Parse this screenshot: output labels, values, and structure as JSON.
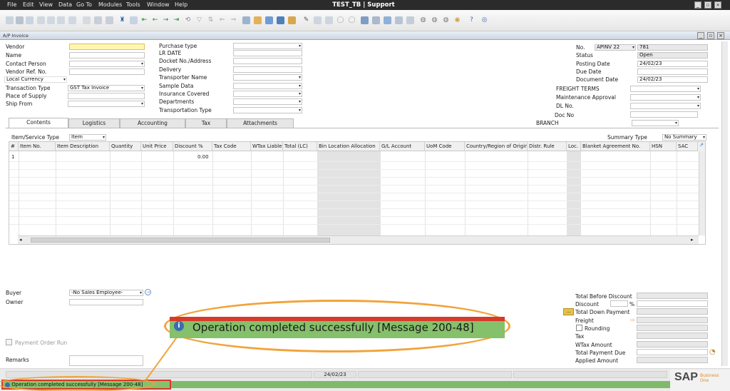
{
  "menu": [
    "File",
    "Edit",
    "View",
    "Data",
    "Go To",
    "Modules",
    "Tools",
    "Window",
    "Help"
  ],
  "app_title": "TEST_TB | Support",
  "window_title": "A/P Invoice",
  "left_fields": [
    {
      "label": "Vendor",
      "value": ""
    },
    {
      "label": "Name",
      "value": ""
    },
    {
      "label": "Contact Person",
      "value": ""
    },
    {
      "label": "Vendor Ref. No.",
      "value": ""
    },
    {
      "label": "Local Currency",
      "value": ""
    },
    {
      "label": "Transaction Type",
      "value": "GST Tax Invoice"
    },
    {
      "label": "Place of Supply",
      "value": ""
    },
    {
      "label": "Ship From",
      "value": ""
    }
  ],
  "mid_fields": [
    "Purchase type",
    "LR DATE",
    "Docket No./Address",
    "Delivery",
    "Transporter Name",
    "Sample Data",
    "Insurance Covered",
    "Departments",
    "Transportation Type"
  ],
  "right_fields": {
    "no_label": "No.",
    "series": "APINV 22",
    "doc_number": "781",
    "status_label": "Status",
    "status_value": "Open",
    "posting_label": "Posting Date",
    "posting_value": "24/02/23",
    "due_label": "Due Date",
    "due_value": "",
    "docdate_label": "Document Date",
    "docdate_value": "24/02/23"
  },
  "right_udf": [
    "FREIGHT TERMS",
    "Maintenance Approval",
    "DL No.",
    "Doc No",
    "BRANCH"
  ],
  "tabs": [
    "Contents",
    "Logistics",
    "Accounting",
    "Tax",
    "Attachments"
  ],
  "item_service_type_label": "Item/Service Type",
  "item_service_type_value": "Item",
  "summary_type_label": "Summary Type",
  "summary_type_value": "No Summary",
  "columns": [
    "#",
    "Item No.",
    "Item Description",
    "Quantity",
    "Unit Price",
    "Discount %",
    "Tax Code",
    "WTax Liable",
    "Total (LC)",
    "Bin Location Allocation",
    "G/L Account",
    "UoM Code",
    "Country/Region of Origin",
    "Distr. Rule",
    "Loc.",
    "Blanket Agreement No.",
    "HSN",
    "SAC"
  ],
  "row1": {
    "num": "1",
    "discount": "0.00"
  },
  "bottom_left": {
    "buyer_label": "Buyer",
    "buyer_value": "-No Sales Employee-",
    "owner_label": "Owner",
    "owner_value": "",
    "payment_order_label": "Payment Order Run",
    "remarks_label": "Remarks"
  },
  "totals": [
    "Total Before Discount",
    "Discount",
    "Total Down Payment",
    "Freight",
    "Rounding",
    "Tax",
    "WTax Amount",
    "Total Payment Due",
    "Applied Amount"
  ],
  "discount_pct": "%",
  "status_date": "24/02/23",
  "message": "Operation completed successfully  [Message 200-48]",
  "brand": "SAP",
  "brand_sub": "Business One"
}
